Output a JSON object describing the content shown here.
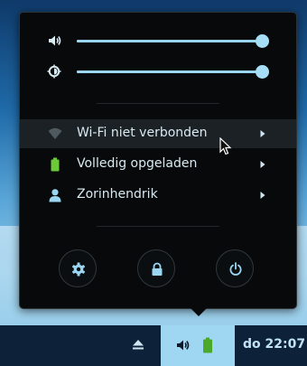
{
  "system_menu": {
    "volume_level": 1.0,
    "brightness_level": 1.0,
    "items": [
      {
        "label": "Wi-Fi niet verbonden",
        "icon": "wifi-icon",
        "hovered": true
      },
      {
        "label": "Volledig opgeladen",
        "icon": "battery-full-icon",
        "hovered": false
      },
      {
        "label": "Zorinhendrik",
        "icon": "user-icon",
        "hovered": false
      }
    ],
    "actions": [
      "settings-icon",
      "lock-icon",
      "power-icon"
    ]
  },
  "taskbar": {
    "clock": "do 22:07"
  },
  "colors": {
    "accent": "#9ad6f2",
    "battery": "#6cc93a",
    "popup_bg": "#07090b",
    "taskbar_bg": "#0d2238",
    "text": "#d9eaf2"
  }
}
